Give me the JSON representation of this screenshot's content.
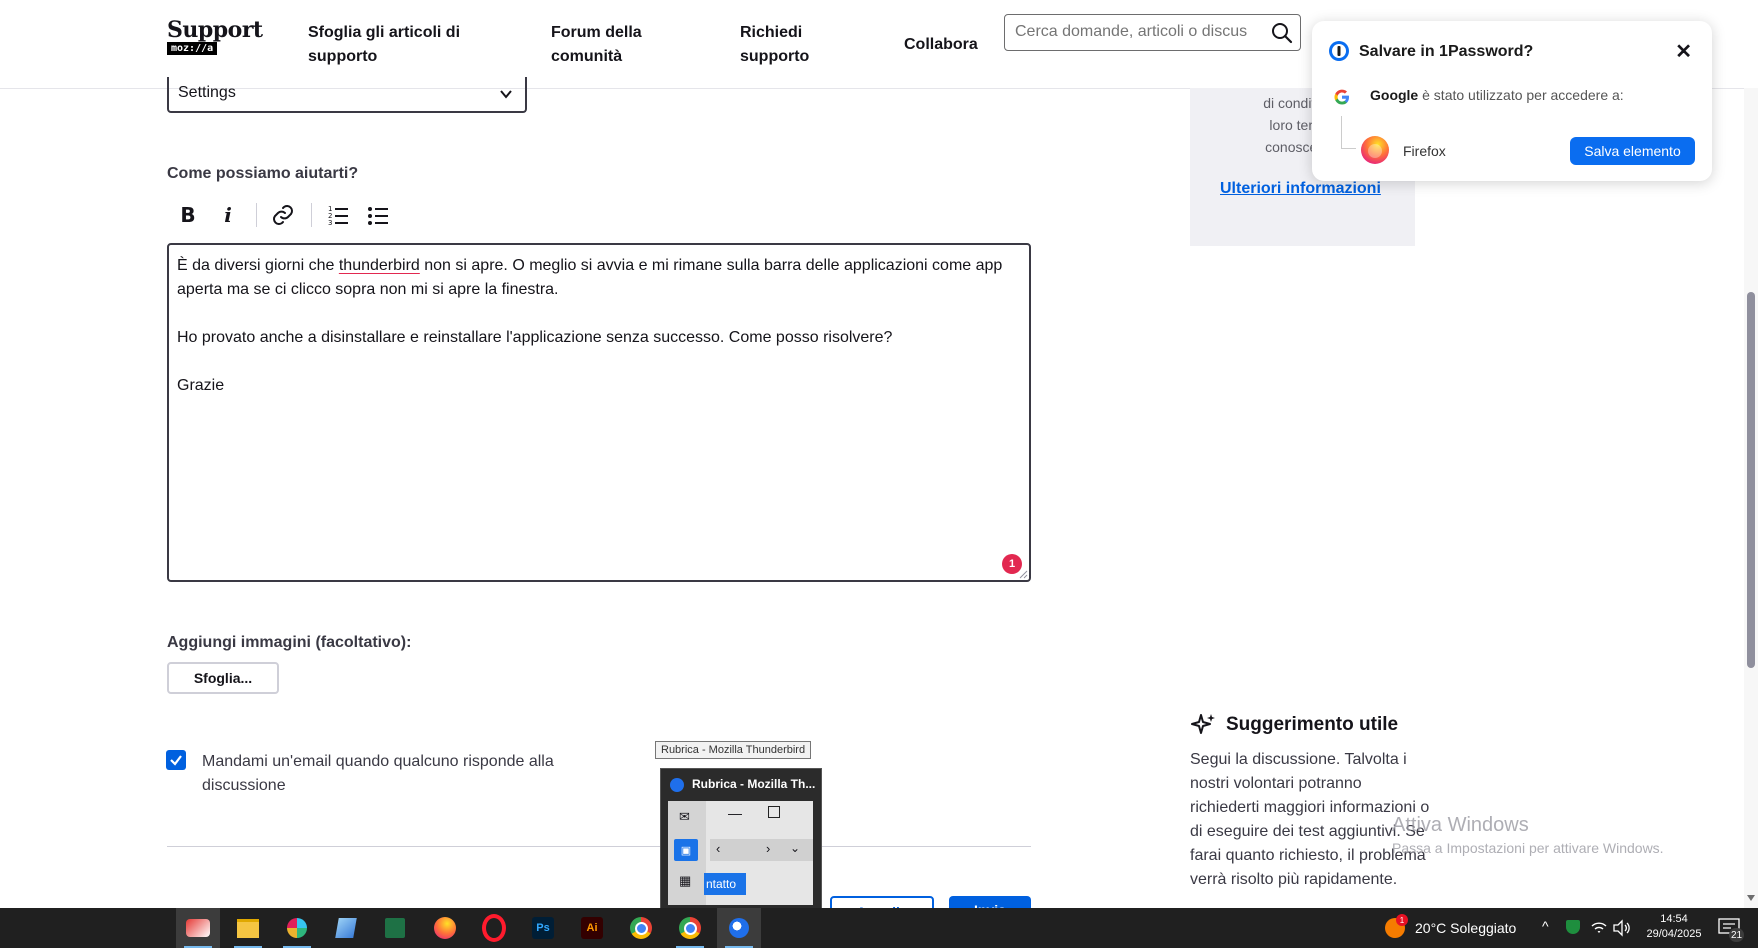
{
  "header": {
    "logo_title": "Support",
    "logo_sub": "moz://a",
    "nav": [
      {
        "line1": "Sfoglia gli articoli di",
        "line2": "supporto"
      },
      {
        "line1": "Forum della",
        "line2": "comunità"
      },
      {
        "line1": "Richiedi",
        "line2": "supporto"
      },
      {
        "line1": "Collabora",
        "line2": ""
      }
    ],
    "search_placeholder": "Cerca domande, articoli o discus"
  },
  "form": {
    "select_value": "Settings",
    "question_label": "Come possiamo aiutarti?",
    "toolbar": [
      "bold-icon",
      "italic-icon",
      "link-icon",
      "ordered-list-icon",
      "bullet-list-icon"
    ],
    "editor": {
      "p1_before": "È da diversi giorni che ",
      "p1_misspelled": "thunderbird",
      "p1_after": " non si apre. O meglio si avvia e mi rimane sulla barra delle applicazioni come app aperta ma se ci clicco sopra non mi si apre la finestra.",
      "p2": "Ho provato anche a disinstallare e reinstallare l'applicazione senza successo. Come posso risolvere?",
      "p3": "Grazie",
      "badge_count": "1"
    },
    "images_label": "Aggiungi immagini (facoltativo):",
    "browse_button": "Sfoglia...",
    "email_checkbox_checked": true,
    "email_checkbox_label": "Mandami un'email quando qualcuno risponde alla discussione",
    "cancel_button": "Annulla",
    "submit_button": "Invia"
  },
  "sidebar": {
    "card_lines": [
      "di condivider",
      "loro tempo",
      "conoscenza"
    ],
    "more_info_link": "Ulteriori informazioni",
    "tip_title": "Suggerimento utile",
    "tip_body": "Segui la discussione. Talvolta i nostri volontari potranno richiederti maggiori informazioni o di eseguire dei test aggiuntivi. Se farai quanto richiesto, il problema verrà risolto più rapidamente."
  },
  "watermark": {
    "line1": "Attiva Windows",
    "line2": "Passa a Impostazioni per attivare Windows."
  },
  "password_popup": {
    "title": "Salvare in 1Password?",
    "account_name": "Google",
    "account_text": " è stato utilizzato per accedere a:",
    "item_name": "Firefox",
    "save_button": "Salva elemento"
  },
  "thumbnail_preview": {
    "tooltip": "Rubrica - Mozilla Thunderbird",
    "title": "Rubrica - Mozilla Th...",
    "contact_fragment": "ntatto"
  },
  "taskbar": {
    "weather_temp": "20°C",
    "weather_desc": "Soleggiato",
    "weather_badge": "1",
    "time": "14:54",
    "date": "29/04/2025",
    "notifications": "21"
  },
  "colors": {
    "accent_blue": "#0060df",
    "popup_blue": "#0a6df0",
    "badge_red": "#e22850",
    "taskbar": "#202020"
  }
}
